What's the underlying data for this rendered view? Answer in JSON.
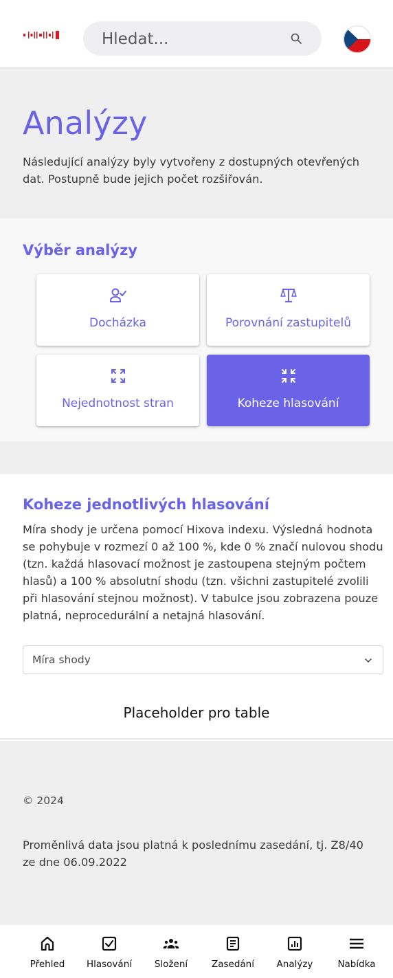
{
  "header": {
    "search_placeholder": "Hledat...",
    "logo": "site-logo",
    "language_flag": "czech-flag-icon"
  },
  "intro": {
    "title": "Analýzy",
    "description": "Následující analýzy byly vytvořeny z dostupných otevřených dat. Postupně bude jejich počet rozšiřován."
  },
  "selector": {
    "title": "Výběr analýzy",
    "cards": [
      {
        "label": "Docházka",
        "icon": "person-check-icon",
        "active": false
      },
      {
        "label": "Porovnání zastupitelů",
        "icon": "scales-icon",
        "active": false
      },
      {
        "label": "Nejednotnost stran",
        "icon": "expand-arrows-icon",
        "active": false
      },
      {
        "label": "Koheze hlasování",
        "icon": "collapse-arrows-icon",
        "active": true
      }
    ]
  },
  "cohesion": {
    "title": "Koheze jednotlivých hlasování",
    "description": "Míra shody je určena pomocí Hixova indexu. Výsledná hodnota se pohybuje v rozmezí 0 až 100 %, kde 0 % značí nulovou shodu (tzn. každá hlasovací možnost je zastoupena stejným počtem hlasů) a 100 % absolutní shodu (tzn. všichni zastupitelé zvolili při hlasování stejnou možnost). V tabulce jsou zobrazena pouze platná, neprocedurální a netajná hlasování.",
    "select_value": "Míra shody",
    "table_placeholder": "Placeholder pro table"
  },
  "footer": {
    "copyright": "© 2024",
    "note": "Proměnlivá data jsou platná k poslednímu zasedání, tj. Z8/40 ze dne 06.09.2022"
  },
  "nav": [
    {
      "label": "Přehled",
      "icon": "home-icon"
    },
    {
      "label": "Hlasování",
      "icon": "checkbox-icon"
    },
    {
      "label": "Složení",
      "icon": "group-icon"
    },
    {
      "label": "Zasedání",
      "icon": "document-icon"
    },
    {
      "label": "Analýzy",
      "icon": "chart-icon"
    },
    {
      "label": "Nabídka",
      "icon": "menu-icon"
    }
  ],
  "colors": {
    "accent": "#6a63e8",
    "active_card": "#6b63e7",
    "section_bg": "#efefef",
    "logo_red": "#d71920"
  }
}
